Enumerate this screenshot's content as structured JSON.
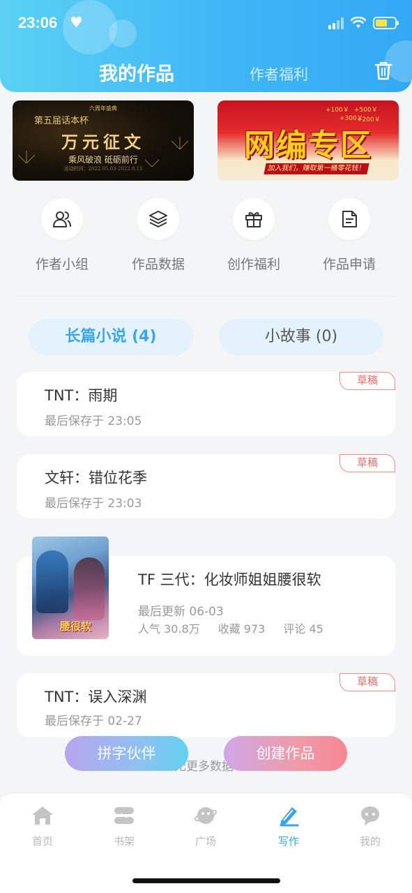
{
  "status_bar": {
    "time": "23:06"
  },
  "header": {
    "title": "我的作品",
    "tab_welfare": "作者福利"
  },
  "banners": {
    "left": {
      "top_small": "六周年盛典",
      "headline": "第五届话本杯",
      "title": "万元征文",
      "slogan": "乘风破浪 砥砺前行",
      "dates": "活动时间：2022.05.03-2022.8.15"
    },
    "right": {
      "title": "网编专区",
      "strip": "加入我们，赚取第一桶零花钱！",
      "coins": [
        "+100￥",
        "+300￥",
        "+500￥",
        "+200￥"
      ]
    }
  },
  "quick_actions": [
    {
      "label": "作者小组",
      "icon": "author-group-icon"
    },
    {
      "label": "作品数据",
      "icon": "work-data-icon"
    },
    {
      "label": "创作福利",
      "icon": "gift-icon"
    },
    {
      "label": "作品申请",
      "icon": "apply-icon"
    }
  ],
  "segments": {
    "long": "长篇小说 (4)",
    "short": "小故事 (0)"
  },
  "works": [
    {
      "title": "TNT：雨期",
      "subtitle": "最后保存于 23:05",
      "badge": "草稿"
    },
    {
      "title": "文轩：错位花季",
      "subtitle": "最后保存于 23:03",
      "badge": "草稿"
    },
    {
      "title": "TF 三代：化妆师姐姐腰很软",
      "subtitle": "最后更新 06-03",
      "stats": [
        "人气 30.8万",
        "收藏 973",
        "评论 45"
      ],
      "cover_text": "腰很软"
    },
    {
      "title": "TNT：误入深渊",
      "subtitle": "最后保存于 02-27",
      "badge": "草稿"
    }
  ],
  "no_more": "无更多数据",
  "fabs": {
    "partner": "拼字伙伴",
    "create": "创建作品"
  },
  "nav": [
    {
      "label": "首页",
      "icon": "home-icon"
    },
    {
      "label": "书架",
      "icon": "bookshelf-icon"
    },
    {
      "label": "广场",
      "icon": "plaza-icon"
    },
    {
      "label": "写作",
      "icon": "write-icon"
    },
    {
      "label": "我的",
      "icon": "profile-icon"
    }
  ],
  "colors": {
    "accent": "#3aa2ea",
    "header_start": "#5ad1f4",
    "header_end": "#33a8f5",
    "badge": "#e96c6c"
  }
}
